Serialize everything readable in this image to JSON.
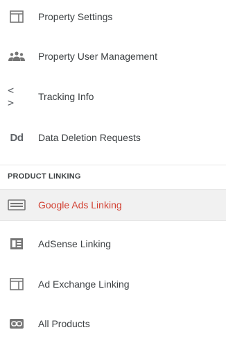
{
  "menu": {
    "items": [
      {
        "label": "Property Settings",
        "icon": "window-icon"
      },
      {
        "label": "Property User Management",
        "icon": "people-icon"
      },
      {
        "label": "Tracking Info",
        "icon": "code-icon",
        "icon_text": "< >"
      },
      {
        "label": "Data Deletion Requests",
        "icon": "dd-icon",
        "icon_text": "Dd"
      }
    ],
    "section_header": "PRODUCT LINKING",
    "linking_items": [
      {
        "label": "Google Ads Linking",
        "icon": "ads-icon",
        "active": true
      },
      {
        "label": "AdSense Linking",
        "icon": "adsense-icon"
      },
      {
        "label": "Ad Exchange Linking",
        "icon": "window-icon"
      },
      {
        "label": "All Products",
        "icon": "link-icon"
      }
    ]
  },
  "colors": {
    "active_text": "#d23f31",
    "active_bg": "#f1f1f1",
    "icon": "#757575",
    "text": "#3c4043"
  }
}
